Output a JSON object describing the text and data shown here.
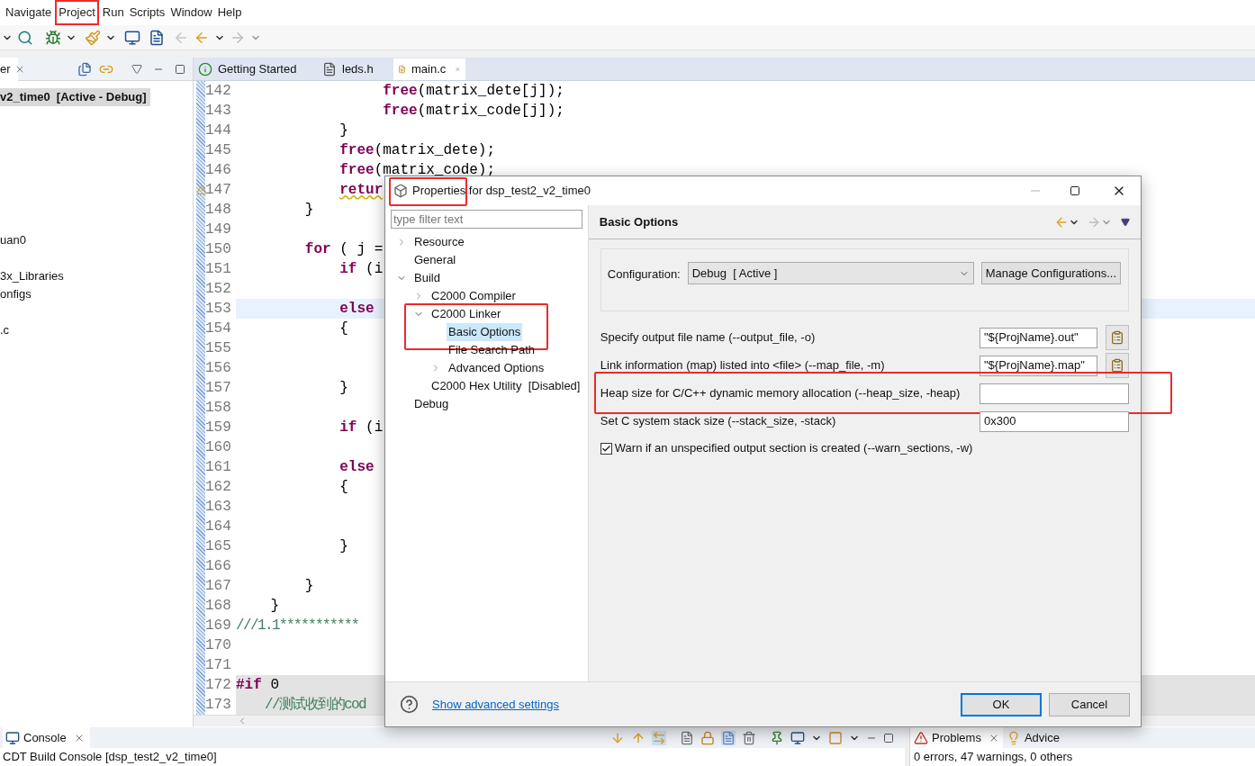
{
  "menu": [
    {
      "label": "Navigate",
      "annotated": false
    },
    {
      "label": "Project",
      "annotated": true
    },
    {
      "label": "Run",
      "annotated": false
    },
    {
      "label": "Scripts",
      "annotated": false
    },
    {
      "label": "Window",
      "annotated": false
    },
    {
      "label": "Help",
      "annotated": false
    }
  ],
  "project_explorer": {
    "tab": "er",
    "items": [
      {
        "label": "v2_time0  [Active - Debug]",
        "selected": true
      },
      {
        "label": "uan0",
        "selected": false
      },
      {
        "label": "3x_Libraries",
        "selected": false
      },
      {
        "label": "onfigs",
        "selected": false
      },
      {
        "label": ".c",
        "selected": false
      }
    ]
  },
  "editor": {
    "tabs": [
      {
        "label": "Getting Started",
        "kind": "welcome",
        "selected": false
      },
      {
        "label": "leds.h",
        "kind": "header",
        "selected": false
      },
      {
        "label": "main.c",
        "kind": "source",
        "selected": true
      }
    ],
    "lines": [
      {
        "number": "142",
        "segments": [
          {
            "kind": "keyword",
            "text": "                 free"
          },
          {
            "kind": "plain",
            "text": "(matrix_dete[j]);"
          }
        ]
      },
      {
        "number": "143",
        "segments": [
          {
            "kind": "keyword",
            "text": "                 free"
          },
          {
            "kind": "plain",
            "text": "(matrix_code[j]);"
          }
        ]
      },
      {
        "number": "144",
        "segments": [
          {
            "kind": "plain",
            "text": "            }"
          }
        ]
      },
      {
        "number": "145",
        "segments": [
          {
            "kind": "keyword",
            "text": "            free"
          },
          {
            "kind": "plain",
            "text": "(matrix_dete);"
          }
        ]
      },
      {
        "number": "146",
        "segments": [
          {
            "kind": "keyword",
            "text": "            free"
          },
          {
            "kind": "plain",
            "text": "(matrix_code);"
          }
        ]
      },
      {
        "number": "147",
        "warning": true,
        "segments": [
          {
            "kind": "keyword",
            "text": "            retur"
          }
        ]
      },
      {
        "number": "148",
        "segments": [
          {
            "kind": "plain",
            "text": "        }"
          }
        ]
      },
      {
        "number": "149"
      },
      {
        "number": "150",
        "segments": [
          {
            "kind": "keyword",
            "text": "        for"
          },
          {
            "kind": "plain",
            "text": " ( j ="
          }
        ]
      },
      {
        "number": "151",
        "segments": [
          {
            "kind": "keyword",
            "text": "            if"
          },
          {
            "kind": "plain",
            "text": " (i"
          }
        ]
      },
      {
        "number": "152"
      },
      {
        "number": "153",
        "current": true,
        "segments": [
          {
            "kind": "keyword",
            "text": "            else"
          }
        ]
      },
      {
        "number": "154",
        "segments": [
          {
            "kind": "plain",
            "text": "            {"
          }
        ]
      },
      {
        "number": "155"
      },
      {
        "number": "156"
      },
      {
        "number": "157",
        "segments": [
          {
            "kind": "plain",
            "text": "            }"
          }
        ]
      },
      {
        "number": "158"
      },
      {
        "number": "159",
        "segments": [
          {
            "kind": "keyword",
            "text": "            if"
          },
          {
            "kind": "plain",
            "text": " (i"
          }
        ]
      },
      {
        "number": "160"
      },
      {
        "number": "161",
        "segments": [
          {
            "kind": "keyword",
            "text": "            else"
          }
        ]
      },
      {
        "number": "162",
        "segments": [
          {
            "kind": "plain",
            "text": "            {"
          }
        ]
      },
      {
        "number": "163"
      },
      {
        "number": "164"
      },
      {
        "number": "165",
        "segments": [
          {
            "kind": "plain",
            "text": "            }"
          }
        ]
      },
      {
        "number": "166"
      },
      {
        "number": "167",
        "segments": [
          {
            "kind": "plain",
            "text": "        }"
          }
        ]
      },
      {
        "number": "168",
        "segments": [
          {
            "kind": "plain",
            "text": "    }"
          }
        ]
      },
      {
        "number": "169",
        "segments": [
          {
            "kind": "comment",
            "text": "///1.1***********"
          }
        ]
      },
      {
        "number": "170"
      },
      {
        "number": "171"
      },
      {
        "number": "172",
        "shaded": true,
        "segments": [
          {
            "kind": "keyword",
            "text": "#if"
          },
          {
            "kind": "plain",
            "text": " 0"
          }
        ]
      },
      {
        "number": "173",
        "shaded": true,
        "segments": [
          {
            "kind": "comment",
            "text": "    //测试收到的cod"
          }
        ]
      }
    ]
  },
  "dialog": {
    "title": "Properties for dsp_test2_v2_time0",
    "title_annotated": true,
    "filter": {
      "placeholder": "type filter text"
    },
    "tree": [
      {
        "label": "Resource",
        "expanded": false,
        "selected": false
      },
      {
        "label": "General",
        "selected": false
      },
      {
        "label": "Build",
        "expanded": true,
        "selected": false,
        "children": [
          {
            "label": "C2000 Compiler",
            "expanded": false,
            "selected": false
          },
          {
            "label": "C2000 Linker",
            "expanded": true,
            "selected": false,
            "annotated": true,
            "children": [
              {
                "label": "Basic Options",
                "selected": true
              },
              {
                "label": "File Search Path",
                "selected": false
              },
              {
                "label": "Advanced Options",
                "expanded": false,
                "selected": false
              }
            ]
          },
          {
            "label": "C2000 Hex Utility  [Disabled]",
            "selected": false
          }
        ]
      },
      {
        "label": "Debug",
        "selected": false
      }
    ],
    "page_title": "Basic Options",
    "configuration": {
      "label": "Configuration:",
      "value": "Debug  [ Active ]",
      "button": "Manage Configurations..."
    },
    "options": [
      {
        "kind": "text",
        "label": "Specify output file name (--output_file, -o)",
        "value": "\"${ProjName}.out\"",
        "browse": true
      },
      {
        "kind": "text",
        "label": "Link information (map) listed into <file> (--map_file, -m)",
        "value": "\"${ProjName}.map\"",
        "browse": true
      },
      {
        "kind": "text",
        "label": "Heap size for C/C++ dynamic memory allocation (--heap_size, -heap)",
        "annotated": true
      },
      {
        "kind": "text",
        "label": "Set C system stack size (--stack_size, -stack)",
        "value": "0x300"
      },
      {
        "kind": "checkbox",
        "label": "Warn if an unspecified output section is created (--warn_sections, -w)",
        "checked": true
      }
    ],
    "link": "Show advanced settings",
    "buttons": [
      {
        "label": "OK",
        "default": true
      },
      {
        "label": "Cancel",
        "default": false
      }
    ]
  },
  "console": {
    "tab": "Console",
    "text": "CDT Build Console [dsp_test2_v2_time0]"
  },
  "problems": {
    "tabs": [
      {
        "label": "Problems",
        "kind": "problems",
        "selected": true
      },
      {
        "label": "Advice",
        "kind": "advice",
        "selected": false
      }
    ],
    "summary": "0 errors, 47 warnings, 0 others"
  }
}
